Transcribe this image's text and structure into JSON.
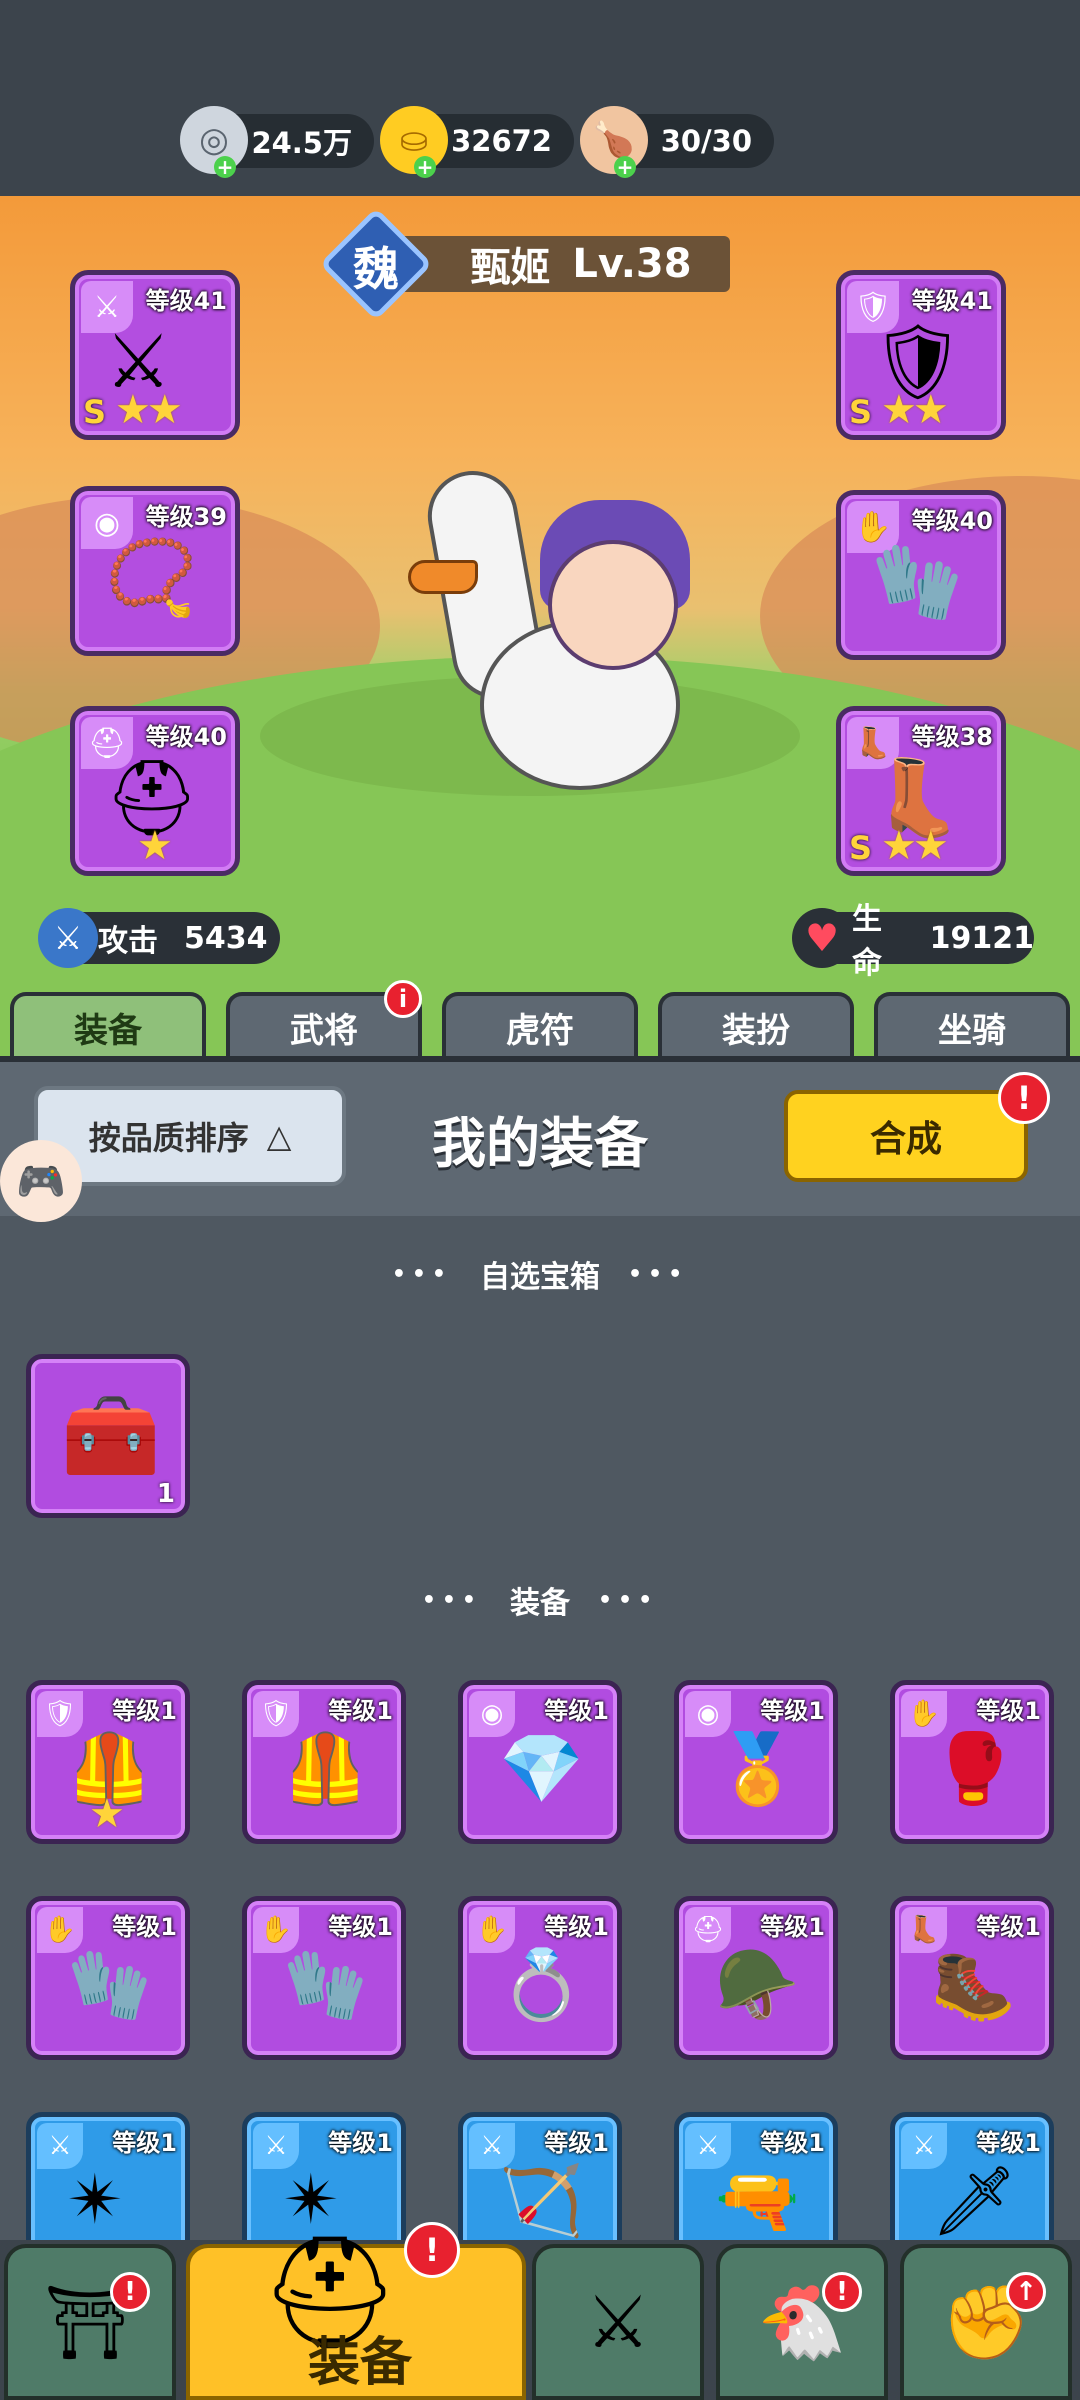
{
  "currencies": [
    {
      "icon": "silver-coin-icon",
      "value": "24.5万"
    },
    {
      "icon": "gold-ingot-icon",
      "value": "32672"
    },
    {
      "icon": "meat-stamina-icon",
      "value": "30/30"
    }
  ],
  "hero": {
    "kingdom": "魏",
    "name": "甄姬",
    "level": "Lv.38",
    "attack_label": "攻击",
    "attack_value": "5434",
    "hp_label": "生命",
    "hp_value": "19121"
  },
  "equipped": {
    "left": [
      {
        "type_icon": "sword-type-icon",
        "level": "等级41",
        "art": "⚔",
        "grade": "S",
        "stars": "★★"
      },
      {
        "type_icon": "medal-type-icon",
        "level": "等级39",
        "art": "📿",
        "grade": "",
        "stars": ""
      },
      {
        "type_icon": "helmet-type-icon",
        "level": "等级40",
        "art": "⛑",
        "grade": "",
        "stars": "★"
      }
    ],
    "right": [
      {
        "type_icon": "armor-type-icon",
        "level": "等级41",
        "art": "🛡",
        "grade": "S",
        "stars": "★★"
      },
      {
        "type_icon": "gauntlet-type-icon",
        "level": "等级40",
        "art": "🧤",
        "grade": "",
        "stars": ""
      },
      {
        "type_icon": "boots-type-icon",
        "level": "等级38",
        "art": "👢",
        "grade": "S",
        "stars": "★★"
      }
    ]
  },
  "tabs": [
    {
      "label": "装备",
      "active": true
    },
    {
      "label": "武将",
      "badge": "i"
    },
    {
      "label": "虎符"
    },
    {
      "label": "装扮"
    },
    {
      "label": "坐骑"
    }
  ],
  "equip_panel": {
    "sort_label": "按品质排序",
    "sort_arrow": "△",
    "title": "我的装备",
    "merge_label": "合成",
    "merge_badge": "!"
  },
  "chest_section": {
    "title": "自选宝箱",
    "items": [
      {
        "icon": "treasure-chest-icon",
        "count": "1"
      }
    ]
  },
  "equipment_section": {
    "title": "装备",
    "rows": [
      [
        {
          "type": "armor",
          "level": "等级1",
          "art": "🦺",
          "stars": "★",
          "color": "purple"
        },
        {
          "type": "armor",
          "level": "等级1",
          "art": "🦺",
          "stars": "",
          "color": "purple"
        },
        {
          "type": "medal",
          "level": "等级1",
          "art": "💎",
          "stars": "",
          "color": "purple"
        },
        {
          "type": "medal",
          "level": "等级1",
          "art": "🏅",
          "stars": "",
          "color": "purple"
        },
        {
          "type": "gauntlet",
          "level": "等级1",
          "art": "🥊",
          "stars": "",
          "color": "purple"
        }
      ],
      [
        {
          "type": "gauntlet",
          "level": "等级1",
          "art": "🧤",
          "stars": "",
          "color": "purple"
        },
        {
          "type": "gauntlet",
          "level": "等级1",
          "art": "🧤",
          "stars": "",
          "color": "purple"
        },
        {
          "type": "gauntlet",
          "level": "等级1",
          "art": "💍",
          "stars": "",
          "color": "purple"
        },
        {
          "type": "helmet",
          "level": "等级1",
          "art": "🪖",
          "stars": "",
          "color": "purple"
        },
        {
          "type": "boots",
          "level": "等级1",
          "art": "🥾",
          "stars": "",
          "color": "purple"
        }
      ],
      [
        {
          "type": "sword",
          "level": "等级1",
          "art": "✴",
          "stars": "",
          "color": "blue"
        },
        {
          "type": "sword",
          "level": "等级1",
          "art": "✴",
          "stars": "",
          "color": "blue"
        },
        {
          "type": "sword",
          "level": "等级1",
          "art": "🏹",
          "stars": "",
          "color": "blue"
        },
        {
          "type": "sword",
          "level": "等级1",
          "art": "🔫",
          "stars": "",
          "color": "blue"
        },
        {
          "type": "sword",
          "level": "等级1",
          "art": "🗡",
          "stars": "",
          "color": "blue"
        }
      ]
    ]
  },
  "bottom_nav": {
    "items": [
      {
        "icon": "gate-icon",
        "badge": "!"
      },
      {
        "icon": "helmet-icon",
        "label": "装备",
        "badge": "!",
        "active": true
      },
      {
        "icon": "battle-icon"
      },
      {
        "icon": "chicken-hero-icon",
        "badge": "!"
      },
      {
        "icon": "fist-upgrade-icon",
        "badge": "↑"
      }
    ]
  },
  "colors": {
    "purple_rarity": "#b14ce0",
    "blue_rarity": "#2f9be8",
    "active_tab": "#8fc07a",
    "merge_button": "#ffd21f",
    "badge_red": "#e8212f"
  }
}
